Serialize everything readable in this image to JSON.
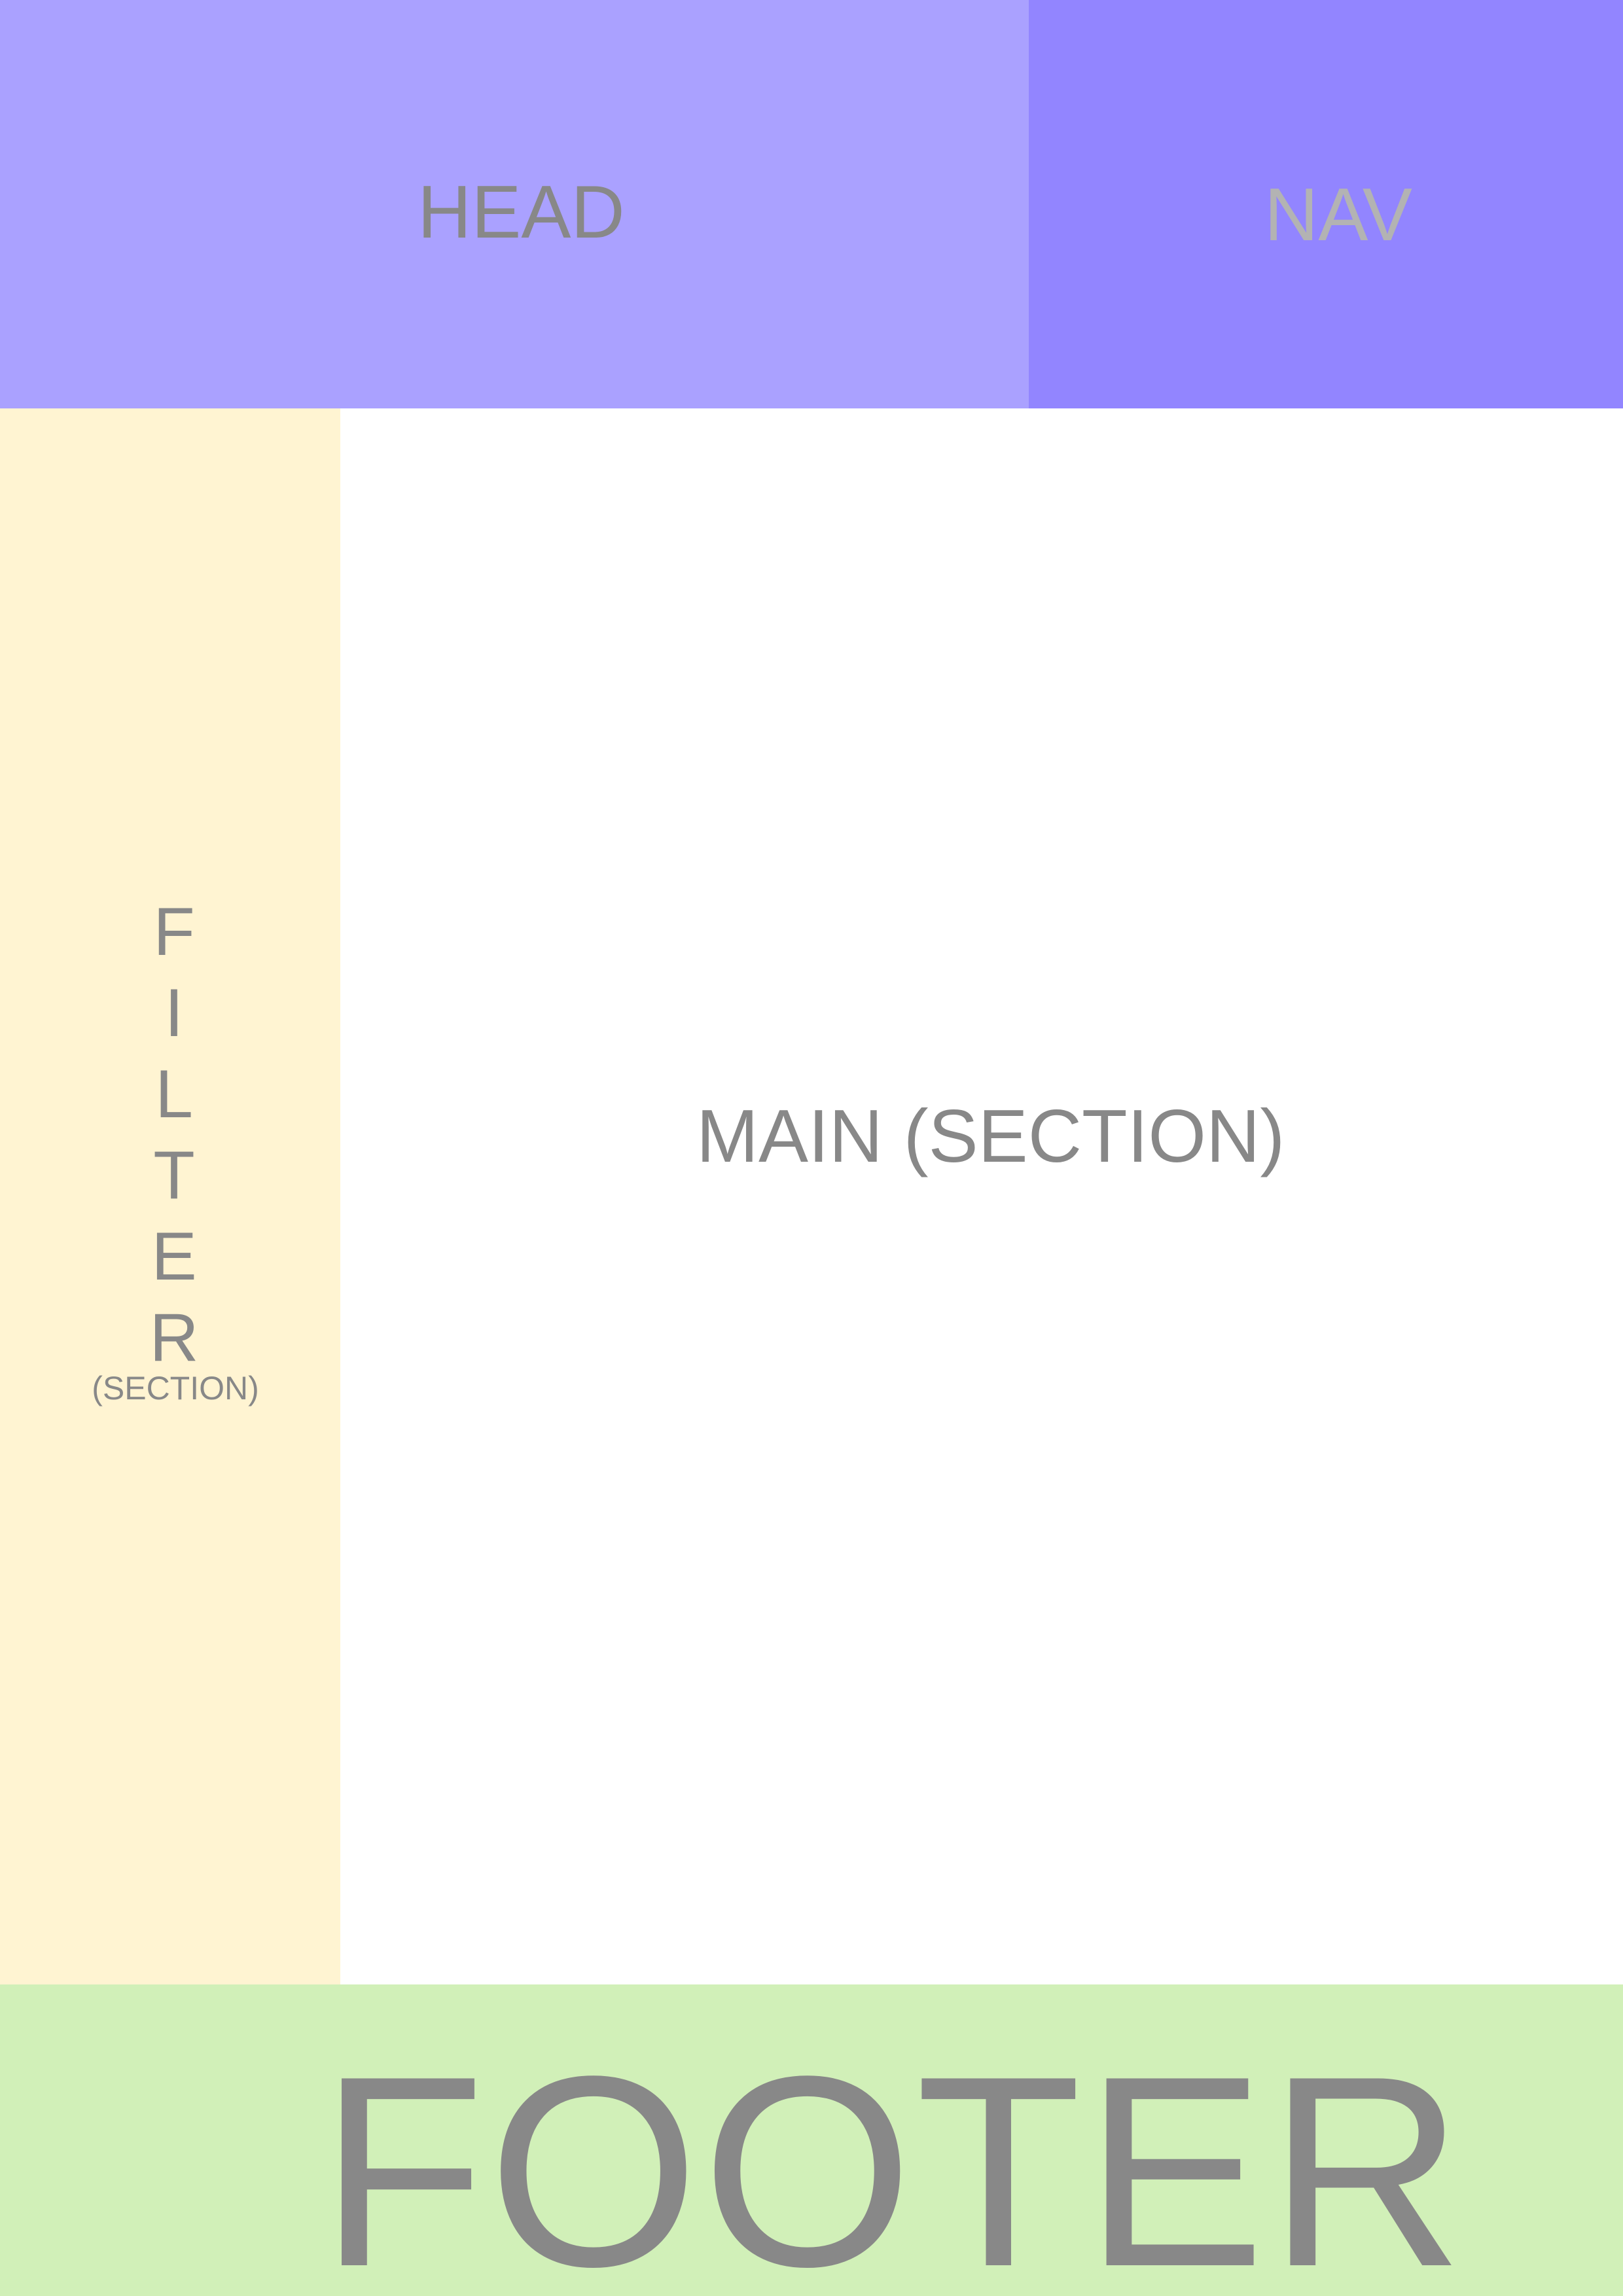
{
  "regions": {
    "head": {
      "label": "HEAD",
      "color": "#aaa1ff"
    },
    "nav": {
      "label": "NAV",
      "color": "#9285ff"
    },
    "filter": {
      "letters": [
        "F",
        "I",
        "L",
        "T",
        "E",
        "R"
      ],
      "sublabel": "(SECTION)",
      "color": "#fff4d2"
    },
    "main": {
      "label": "MAIN (SECTION)",
      "color": "#ffffff"
    },
    "footer": {
      "label": "FOOTER",
      "color": "#d1f0b8"
    }
  },
  "text_color": "#888888"
}
